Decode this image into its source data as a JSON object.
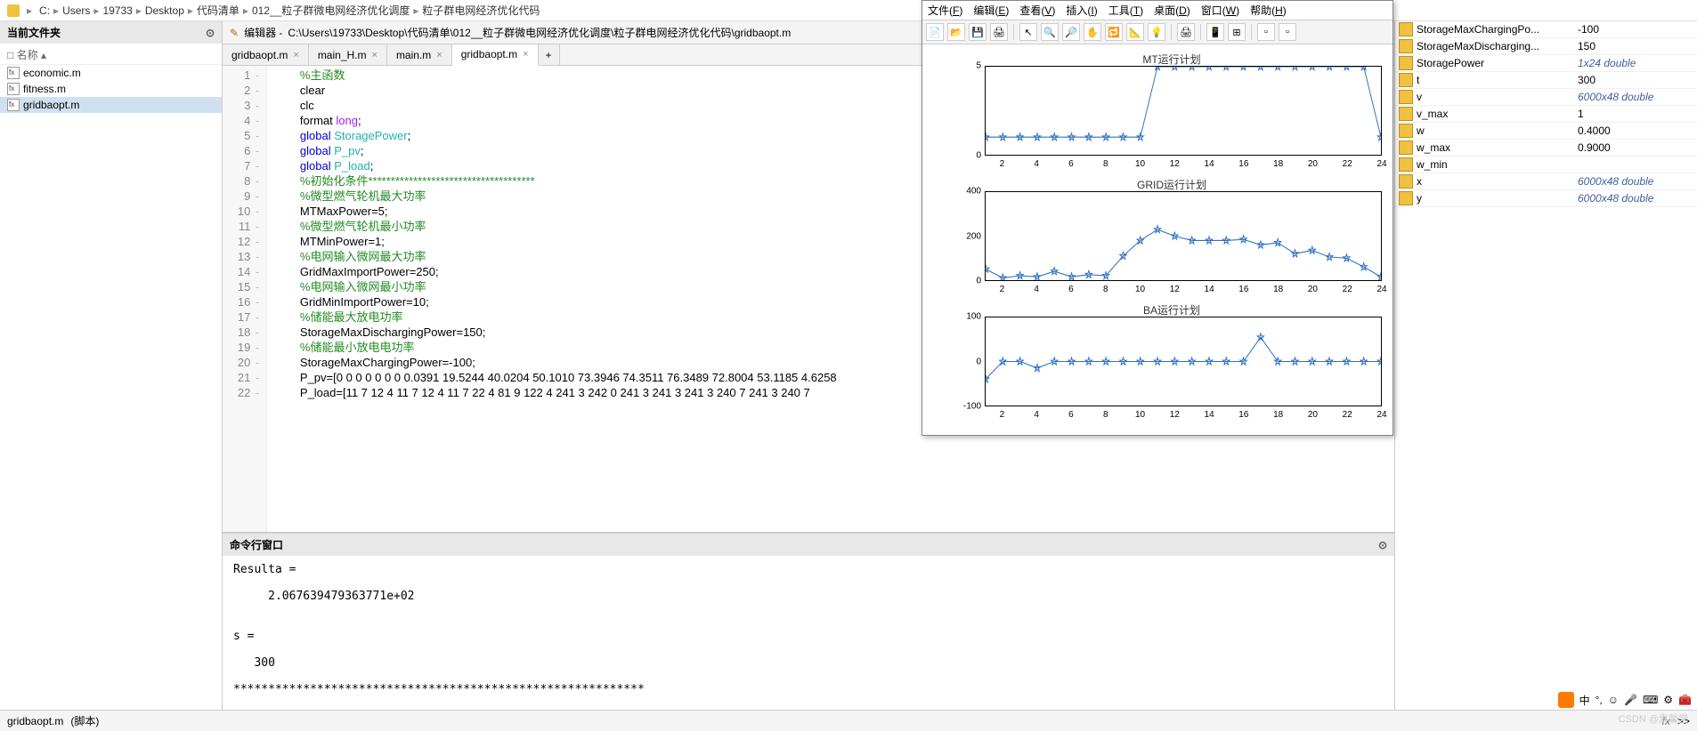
{
  "breadcrumb": [
    "C:",
    "Users",
    "19733",
    "Desktop",
    "代码清单",
    "012__粒子群微电网经济优化调度",
    "粒子群电网经济优化代码"
  ],
  "left_panel": {
    "title": "当前文件夹",
    "column": "名称",
    "files": [
      "economic.m",
      "fitness.m",
      "gridbaopt.m"
    ],
    "selected": "gridbaopt.m"
  },
  "editor": {
    "title_prefix": "编辑器 - ",
    "path": "C:\\Users\\19733\\Desktop\\代码清单\\012__粒子群微电网经济优化调度\\粒子群电网经济优化代码\\gridbaopt.m",
    "tabs": [
      "gridbaopt.m",
      "main_H.m",
      "main.m",
      "gridbaopt.m"
    ],
    "active_tab": 3,
    "lines": [
      {
        "n": 1,
        "t": "comment",
        "text": "%主函数"
      },
      {
        "n": 2,
        "t": "plain",
        "text": "clear"
      },
      {
        "n": 3,
        "t": "plain",
        "text": "clc"
      },
      {
        "n": 4,
        "t": "format",
        "text": "format ",
        "kw": "long",
        "tail": ";"
      },
      {
        "n": 5,
        "t": "global",
        "text": "global ",
        "var": "StoragePower",
        "tail": ";"
      },
      {
        "n": 6,
        "t": "global",
        "text": "global ",
        "var": "P_pv",
        "tail": ";"
      },
      {
        "n": 7,
        "t": "global",
        "text": "global ",
        "var": "P_load",
        "tail": ";"
      },
      {
        "n": 8,
        "t": "comment",
        "text": "%初始化条件*************************************"
      },
      {
        "n": 9,
        "t": "comment",
        "text": "%微型燃气轮机最大功率"
      },
      {
        "n": 10,
        "t": "plain",
        "text": "MTMaxPower=5;"
      },
      {
        "n": 11,
        "t": "comment",
        "text": "%微型燃气轮机最小功率"
      },
      {
        "n": 12,
        "t": "plain",
        "text": "MTMinPower=1;"
      },
      {
        "n": 13,
        "t": "comment",
        "text": "%电网输入微网最大功率"
      },
      {
        "n": 14,
        "t": "plain",
        "text": "GridMaxImportPower=250;"
      },
      {
        "n": 15,
        "t": "comment",
        "text": "%电网输入微网最小功率"
      },
      {
        "n": 16,
        "t": "plain",
        "text": "GridMinImportPower=10;"
      },
      {
        "n": 17,
        "t": "comment",
        "text": "%储能最大放电功率"
      },
      {
        "n": 18,
        "t": "plain",
        "text": "StorageMaxDischargingPower=150;"
      },
      {
        "n": 19,
        "t": "comment",
        "text": "%储能最小放电电功率"
      },
      {
        "n": 20,
        "t": "plain",
        "text": "StorageMaxChargingPower=-100;"
      },
      {
        "n": 21,
        "t": "plain",
        "text": "P_pv=[0 0 0 0 0 0 0 0.0391 19.5244 40.0204 50.1010 73.3946 74.3511 76.3489 72.8004 53.1185 4.6258"
      },
      {
        "n": 22,
        "t": "plain",
        "text": "P_load=[11 7 12 4 11 7 12 4 11 7 22 4 81 9 122 4 241 3 242 0 241 3 241 3 241 3 240 7 241 3 240 7"
      }
    ]
  },
  "cmd": {
    "title": "命令行窗口",
    "output": "Resulta =\n\n     2.067639479363771e+02\n\n\ns =\n\n   300\n\n***********************************************************",
    "prompt": ">> "
  },
  "status": {
    "file": "gridbaopt.m",
    "type": "(脚本)",
    "fx": "fx"
  },
  "figure": {
    "menus": [
      {
        "l": "文件",
        "u": "F"
      },
      {
        "l": "编辑",
        "u": "E"
      },
      {
        "l": "查看",
        "u": "V"
      },
      {
        "l": "插入",
        "u": "I"
      },
      {
        "l": "工具",
        "u": "T"
      },
      {
        "l": "桌面",
        "u": "D"
      },
      {
        "l": "窗口",
        "u": "W"
      },
      {
        "l": "帮助",
        "u": "H"
      }
    ],
    "toolbar_icons": [
      "📄",
      "📂",
      "💾",
      "🖨",
      "",
      "↖",
      "🔍",
      "🔎",
      "✋",
      "🔁",
      "📐",
      "💡",
      "",
      "🖨",
      "",
      "📱",
      "⊞",
      "",
      "▫",
      "▫"
    ],
    "xticks": [
      2,
      4,
      6,
      8,
      10,
      12,
      14,
      16,
      18,
      20,
      22,
      24
    ]
  },
  "chart_data": [
    {
      "type": "line",
      "title": "MT运行计划",
      "x": [
        1,
        2,
        3,
        4,
        5,
        6,
        7,
        8,
        9,
        10,
        11,
        12,
        13,
        14,
        15,
        16,
        17,
        18,
        19,
        20,
        21,
        22,
        23,
        24
      ],
      "values": [
        1,
        1,
        1,
        1,
        1,
        1,
        1,
        1,
        1,
        1,
        5,
        5,
        5,
        5,
        5,
        5,
        5,
        5,
        5,
        5,
        5,
        5,
        5,
        1
      ],
      "ylim": [
        0,
        5
      ],
      "yticks": [
        0,
        5
      ]
    },
    {
      "type": "line",
      "title": "GRID运行计划",
      "x": [
        1,
        2,
        3,
        4,
        5,
        6,
        7,
        8,
        9,
        10,
        11,
        12,
        13,
        14,
        15,
        16,
        17,
        18,
        19,
        20,
        21,
        22,
        23,
        24
      ],
      "values": [
        50,
        10,
        20,
        15,
        40,
        15,
        25,
        20,
        110,
        180,
        230,
        200,
        180,
        180,
        180,
        185,
        160,
        170,
        120,
        135,
        105,
        100,
        60,
        15
      ],
      "ylim": [
        0,
        400
      ],
      "yticks": [
        0,
        200,
        400
      ]
    },
    {
      "type": "line",
      "title": "BA运行计划",
      "x": [
        1,
        2,
        3,
        4,
        5,
        6,
        7,
        8,
        9,
        10,
        11,
        12,
        13,
        14,
        15,
        16,
        17,
        18,
        19,
        20,
        21,
        22,
        23,
        24
      ],
      "values": [
        -40,
        0,
        0,
        -15,
        0,
        0,
        0,
        0,
        0,
        0,
        0,
        0,
        0,
        0,
        0,
        0,
        55,
        0,
        0,
        0,
        0,
        0,
        0,
        0
      ],
      "ylim": [
        -100,
        100
      ],
      "yticks": [
        -100,
        0,
        100
      ]
    }
  ],
  "workspace": {
    "rows": [
      {
        "name": "StorageMaxChargingPo...",
        "val": "-100",
        "italic": false
      },
      {
        "name": "StorageMaxDischarging...",
        "val": "150",
        "italic": false
      },
      {
        "name": "StoragePower",
        "val": "1x24 double",
        "italic": true
      },
      {
        "name": "t",
        "val": "300",
        "italic": false
      },
      {
        "name": "v",
        "val": "6000x48 double",
        "italic": true
      },
      {
        "name": "v_max",
        "val": "1",
        "italic": false
      },
      {
        "name": "w",
        "val": "0.4000",
        "italic": false
      },
      {
        "name": "w_max",
        "val": "0.9000",
        "italic": false
      },
      {
        "name": "w_min",
        "val": "",
        "italic": false
      },
      {
        "name": "x",
        "val": "6000x48 double",
        "italic": true
      },
      {
        "name": "y",
        "val": "6000x48 double",
        "italic": true
      }
    ]
  },
  "tray_color": "#ff7a00",
  "watermark": "CSDN @素馨堂"
}
